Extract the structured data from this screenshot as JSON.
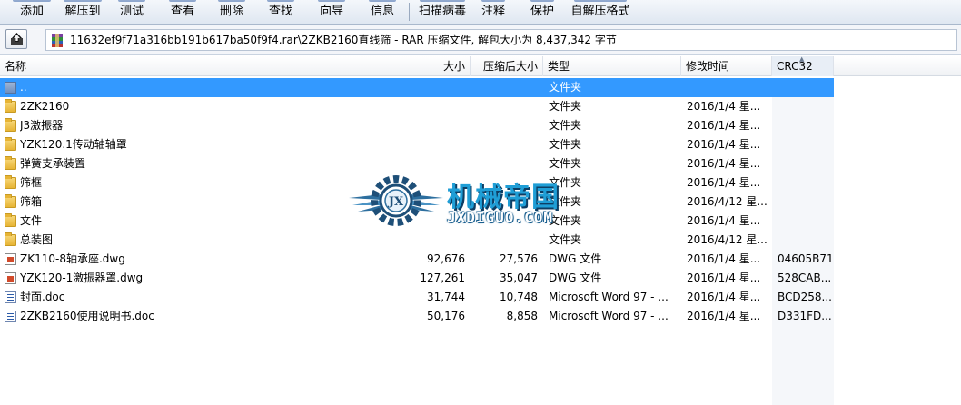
{
  "toolbar": {
    "buttons": [
      "添加",
      "解压到",
      "测试",
      "查看",
      "删除",
      "查找",
      "向导",
      "信息",
      "扫描病毒",
      "注释",
      "保护",
      "自解压格式"
    ]
  },
  "address": {
    "path": "11632ef9f71a316bb191b617ba50f9f4.rar\\2ZKB2160直线筛 - RAR 压缩文件, 解包大小为 8,437,342 字节"
  },
  "columns": {
    "name": "名称",
    "size": "大小",
    "packed": "压缩后大小",
    "type": "类型",
    "mtime": "修改时间",
    "crc": "CRC32"
  },
  "files": [
    {
      "name": "..",
      "size": "",
      "packed": "",
      "type": "文件夹",
      "mtime": "",
      "crc": "",
      "icon": "up-folder-icon"
    },
    {
      "name": "2ZK2160",
      "size": "",
      "packed": "",
      "type": "文件夹",
      "mtime": "2016/1/4 星...",
      "crc": "",
      "icon": "folder-icon"
    },
    {
      "name": "J3激振器",
      "size": "",
      "packed": "",
      "type": "文件夹",
      "mtime": "2016/1/4 星...",
      "crc": "",
      "icon": "folder-icon"
    },
    {
      "name": "YZK120.1传动轴轴罩",
      "size": "",
      "packed": "",
      "type": "文件夹",
      "mtime": "2016/1/4 星...",
      "crc": "",
      "icon": "folder-icon"
    },
    {
      "name": "弹簧支承装置",
      "size": "",
      "packed": "",
      "type": "文件夹",
      "mtime": "2016/1/4 星...",
      "crc": "",
      "icon": "folder-icon"
    },
    {
      "name": "筛框",
      "size": "",
      "packed": "",
      "type": "文件夹",
      "mtime": "2016/1/4 星...",
      "crc": "",
      "icon": "folder-icon"
    },
    {
      "name": "筛箱",
      "size": "",
      "packed": "",
      "type": "文件夹",
      "mtime": "2016/4/12 星...",
      "crc": "",
      "icon": "folder-icon"
    },
    {
      "name": "文件",
      "size": "",
      "packed": "",
      "type": "文件夹",
      "mtime": "2016/1/4 星...",
      "crc": "",
      "icon": "folder-icon"
    },
    {
      "name": "总装图",
      "size": "",
      "packed": "",
      "type": "文件夹",
      "mtime": "2016/4/12 星...",
      "crc": "",
      "icon": "folder-icon"
    },
    {
      "name": "ZK110-8轴承座.dwg",
      "size": "92,676",
      "packed": "27,576",
      "type": "DWG 文件",
      "mtime": "2016/1/4 星...",
      "crc": "04605B71",
      "icon": "dwg-file-icon"
    },
    {
      "name": "YZK120-1激振器罩.dwg",
      "size": "127,261",
      "packed": "35,047",
      "type": "DWG 文件",
      "mtime": "2016/1/4 星...",
      "crc": "528CAB...",
      "icon": "dwg-file-icon"
    },
    {
      "name": "封面.doc",
      "size": "31,744",
      "packed": "10,748",
      "type": "Microsoft Word 97 - ...",
      "mtime": "2016/1/4 星...",
      "crc": "BCD258...",
      "icon": "doc-file-icon"
    },
    {
      "name": "2ZKB2160使用说明书.doc",
      "size": "50,176",
      "packed": "8,858",
      "type": "Microsoft Word 97 - ...",
      "mtime": "2016/1/4 星...",
      "crc": "D331FD...",
      "icon": "doc-file-icon"
    }
  ],
  "watermark": {
    "title": "机械帝国",
    "url": "JXDIGUO.COM"
  },
  "colors": {
    "selection": "#3399ff",
    "watermark_blue": "#1f9ed6"
  }
}
